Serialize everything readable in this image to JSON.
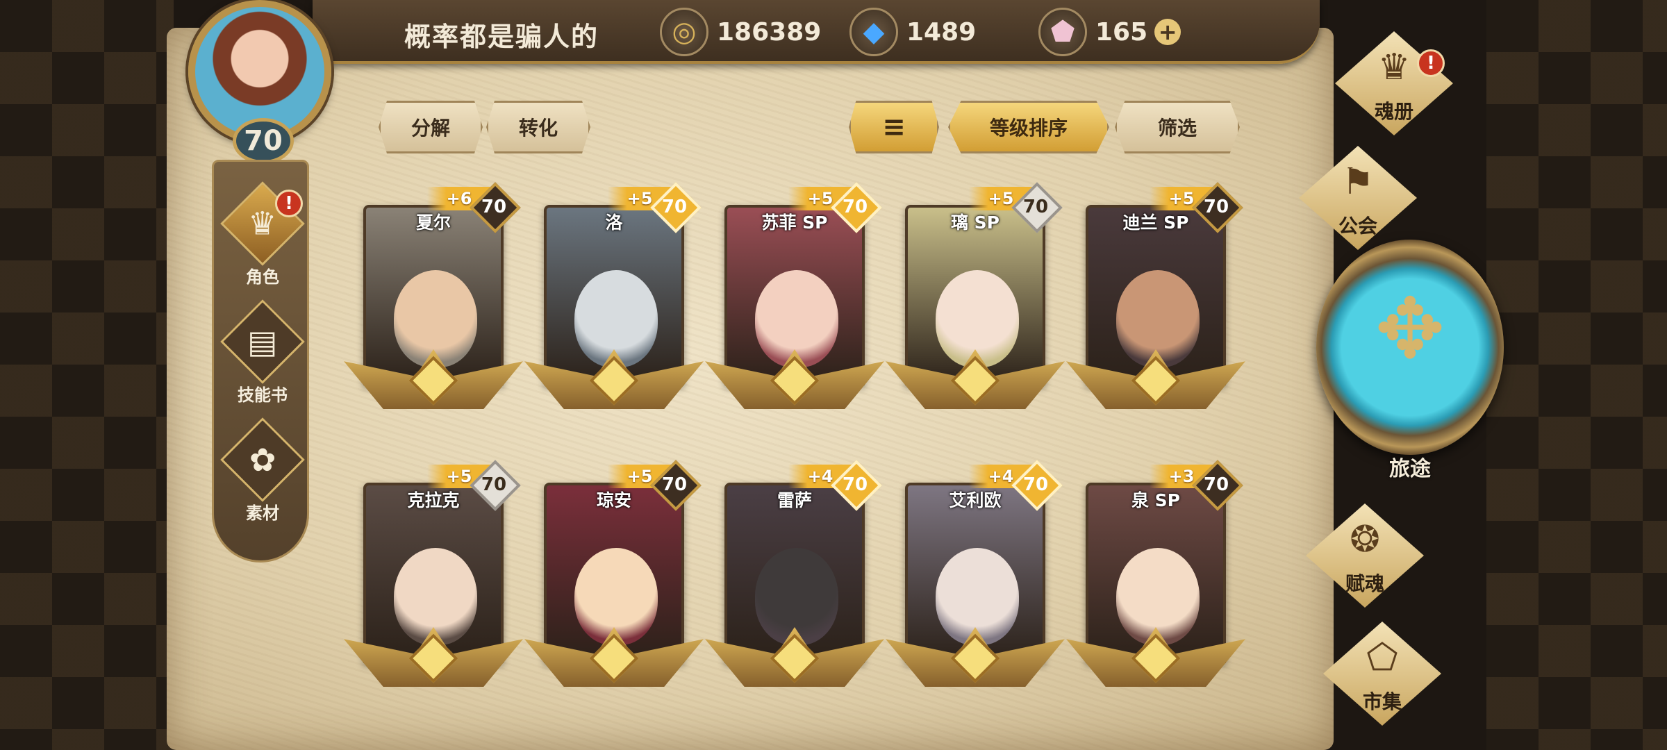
{
  "header": {
    "player_name": "概率都是骗人的",
    "player_level": "70",
    "currencies": [
      {
        "icon": "gold-coin-icon",
        "glyph": "◎",
        "color": "#d7b25a",
        "value": "186389"
      },
      {
        "icon": "blue-crystal-icon",
        "glyph": "◆",
        "color": "#4aa8ff",
        "value": "1489"
      },
      {
        "icon": "pink-gem-icon",
        "glyph": "⬟",
        "color": "#f0c3d3",
        "value": "165"
      }
    ],
    "plus_label": "+"
  },
  "left_nav": {
    "items": [
      {
        "label": "角色",
        "icon": "character-icon",
        "glyph": "♛",
        "active": true,
        "alert": "!"
      },
      {
        "label": "技能书",
        "icon": "skill-book-icon",
        "glyph": "▤"
      },
      {
        "label": "素材",
        "icon": "material-icon",
        "glyph": "✿"
      }
    ]
  },
  "toolbar": {
    "decompose": "分解",
    "convert": "转化",
    "sort_icon": "≡",
    "sort_by_level": "等级排序",
    "filter": "筛选"
  },
  "cards": [
    {
      "name": "夏尔",
      "plus": "+6",
      "level": "70",
      "badge": "dark",
      "bg": "#8a8276",
      "face": "#e9c7a6"
    },
    {
      "name": "洛",
      "plus": "+5",
      "level": "70",
      "badge": "gold",
      "bg": "#6b7680",
      "face": "#d7dcdf"
    },
    {
      "name": "苏菲 SP",
      "plus": "+5",
      "level": "70",
      "badge": "gold",
      "bg": "#9a4e55",
      "face": "#f3d0c0"
    },
    {
      "name": "璃 SP",
      "plus": "+5",
      "level": "70",
      "badge": "silver",
      "bg": "#c9bf8a",
      "face": "#f4e0d2"
    },
    {
      "name": "迪兰 SP",
      "plus": "+5",
      "level": "70",
      "badge": "dark",
      "bg": "#4a3a3c",
      "face": "#c99675"
    },
    {
      "name": "克拉克",
      "plus": "+5",
      "level": "70",
      "badge": "silver",
      "bg": "#5b4c45",
      "face": "#f0d8c4"
    },
    {
      "name": "琼安",
      "plus": "+5",
      "level": "70",
      "badge": "dark",
      "bg": "#7b2f3b",
      "face": "#f6d9b8"
    },
    {
      "name": "雷萨",
      "plus": "+4",
      "level": "70",
      "badge": "gold",
      "bg": "#4b3f45",
      "face": "#3f3a3a"
    },
    {
      "name": "艾利欧",
      "plus": "+4",
      "level": "70",
      "badge": "gold",
      "bg": "#7e7682",
      "face": "#ecdfd8"
    },
    {
      "name": "泉 SP",
      "plus": "+3",
      "level": "70",
      "badge": "dark",
      "bg": "#6e4a45",
      "face": "#f4dcc6"
    }
  ],
  "right_menu": {
    "soul_book": {
      "label": "魂册",
      "glyph": "♛",
      "alert": "!"
    },
    "guild": {
      "label": "公会",
      "glyph": "⚑"
    },
    "journey": {
      "label": "旅途",
      "glyph": "✥"
    },
    "soul_endow": {
      "label": "赋魂",
      "glyph": "❂"
    },
    "market": {
      "label": "市集",
      "glyph": "⬠"
    }
  }
}
